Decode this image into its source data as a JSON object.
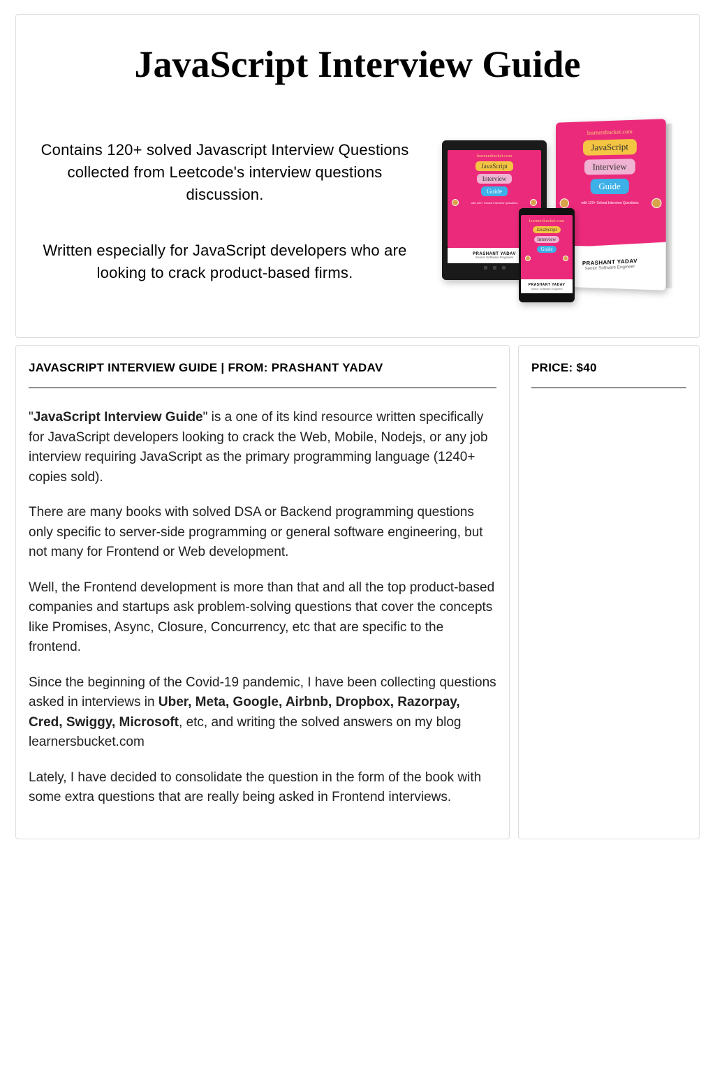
{
  "product": {
    "title": "JavaScript Interview Guide",
    "hero_para_1": "Contains 120+ solved Javascript Interview Questions collected from Leetcode's interview questions discussion.",
    "hero_para_2": "Written especially for JavaScript developers who are looking to crack product-based firms."
  },
  "mockup": {
    "site": "learnersbucket.com",
    "word1": "JavaScript",
    "word2": "Interview",
    "word3": "Guide",
    "solved_caption": "with 120+ Solved Interview Questions",
    "author_name": "PRASHANT YADAV",
    "author_title": "Senior Software Engineer"
  },
  "details": {
    "heading": "JAVASCRIPT INTERVIEW GUIDE | FROM: PRASHANT YADAV",
    "p1_prefix": "\"",
    "p1_bold": "JavaScript Interview Guide",
    "p1_suffix": "\" is a one of its kind resource written specifically for JavaScript developers looking to crack the Web, Mobile, Nodejs, or any job interview requiring JavaScript as the primary programming language (1240+ copies sold).",
    "p2": "There are many books with solved DSA or Backend programming questions only specific to server-side programming or general software engineering, but not many for Frontend or Web development.",
    "p3": "Well, the Frontend development is more than that and all the top product-based companies and startups ask problem-solving questions that cover the concepts like Promises, Async, Closure, Concurrency, etc that are specific to the frontend.",
    "p4_prefix": "Since the beginning of the Covid-19 pandemic, I have been collecting questions asked in interviews in ",
    "p4_bold": "Uber, Meta, Google, Airbnb, Dropbox, Razorpay, Cred, Swiggy, Microsoft",
    "p4_suffix": ", etc, and writing the solved answers on my blog learnersbucket.com",
    "p5": "Lately, I have decided to consolidate the question in the form of the book with some extra questions that are really being asked in Frontend interviews."
  },
  "sidebar": {
    "price_heading": "PRICE: $40"
  }
}
